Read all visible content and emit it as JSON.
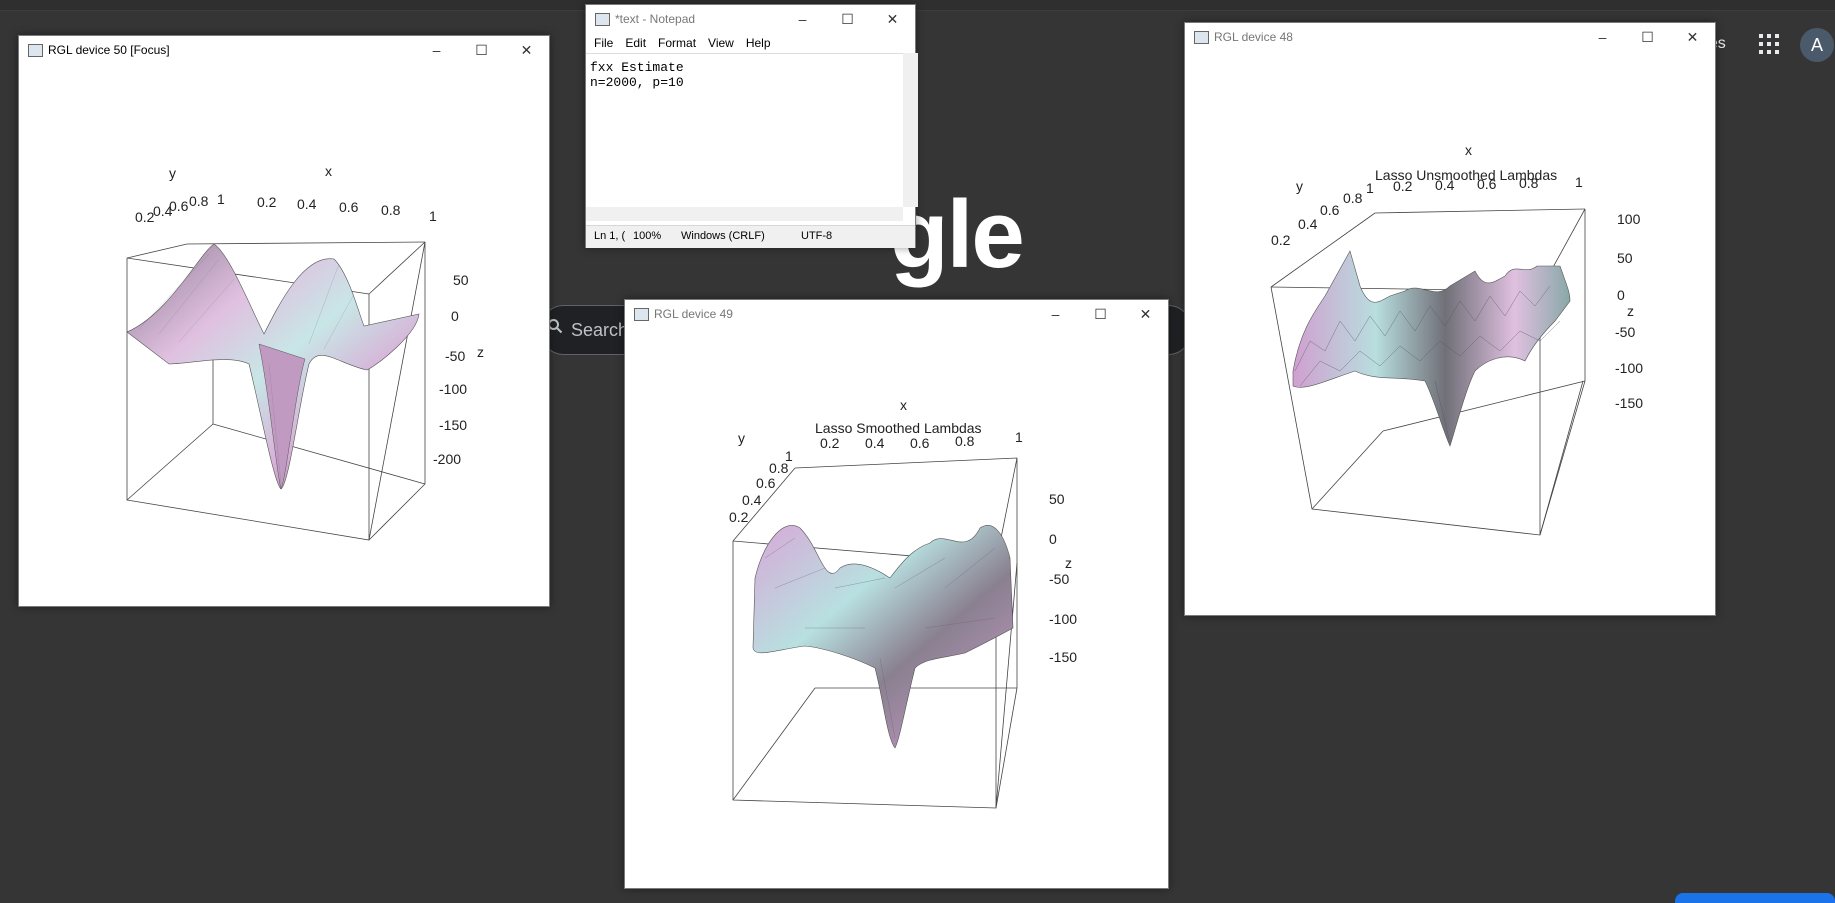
{
  "desktop": {
    "google_logo_partial": "gle",
    "search_placeholder": "Search",
    "images_link": "ges",
    "avatar_letter": "A"
  },
  "windows": {
    "rgl50": {
      "title": "RGL device 50 [Focus]"
    },
    "notepad": {
      "title": "*text - Notepad",
      "menu": [
        "File",
        "Edit",
        "Format",
        "View",
        "Help"
      ],
      "content_line1": "fxx Estimate",
      "content_line2": "n=2000, p=10",
      "status_position": "Ln 1, (",
      "status_zoom": "100%",
      "status_eol": "Windows (CRLF)",
      "status_encoding": "UTF-8"
    },
    "rgl49": {
      "title": "RGL device 49"
    },
    "rgl48": {
      "title": "RGL device 48"
    }
  },
  "chart_data": [
    {
      "type": "surface3d",
      "title": "",
      "xlabel": "x",
      "ylabel": "y",
      "zlabel": "z",
      "x_ticks": [
        "0.2",
        "0.4",
        "0.6",
        "0.8",
        "1"
      ],
      "y_ticks": [
        "0.2",
        "0.4",
        "0.6",
        "0.8",
        "1"
      ],
      "z_ticks": [
        "50",
        "0",
        "-50",
        "-100",
        "-150",
        "-200"
      ],
      "surface_colors": [
        "#b890b4",
        "#e8c8e8",
        "#c8e8e8",
        "#707078"
      ]
    },
    {
      "type": "surface3d",
      "title": "Lasso Smoothed Lambdas",
      "xlabel": "x",
      "ylabel": "y",
      "zlabel": "z",
      "x_ticks": [
        "0.2",
        "0.4",
        "0.6",
        "0.8",
        "1"
      ],
      "y_ticks": [
        "0.2",
        "0.4",
        "0.6",
        "0.8",
        "1"
      ],
      "z_ticks": [
        "50",
        "0",
        "-50",
        "-100",
        "-150"
      ],
      "surface_colors": [
        "#b890b4",
        "#e8c8e8",
        "#c8e8e8",
        "#707078"
      ]
    },
    {
      "type": "surface3d",
      "title": "Lasso Unsmoothed Lambdas",
      "xlabel": "x",
      "ylabel": "y",
      "zlabel": "z",
      "x_ticks": [
        "0.2",
        "0.4",
        "0.6",
        "0.8",
        "1"
      ],
      "y_ticks": [
        "0.2",
        "0.4",
        "0.6",
        "0.8",
        "1"
      ],
      "z_ticks": [
        "100",
        "50",
        "0",
        "-50",
        "-100",
        "-150"
      ],
      "surface_colors": [
        "#b890b4",
        "#e8c8e8",
        "#c8e8e8",
        "#707078"
      ]
    }
  ]
}
